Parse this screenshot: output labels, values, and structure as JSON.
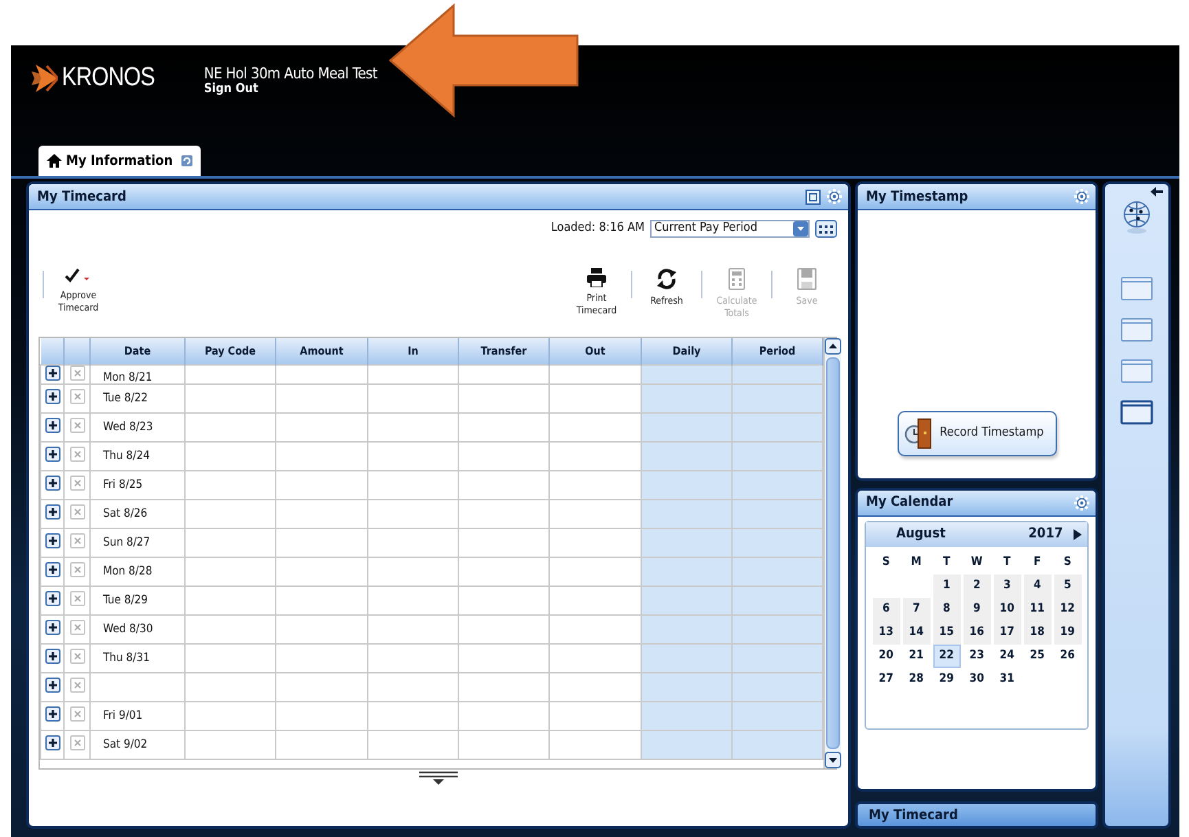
{
  "app": {
    "logo": "KRONOS",
    "user_name": "NE Hol 30m Auto Meal Test",
    "sign_out": "Sign Out"
  },
  "tabs": [
    {
      "label": "My Information",
      "selected": true
    }
  ],
  "timecard": {
    "title": "My Timecard",
    "loaded": "Loaded: 8:16 AM",
    "period": "Current Pay Period",
    "toolbar": [
      {
        "kind": "approve",
        "label": "Approve Timecard",
        "disabled": false
      },
      {
        "kind": "print",
        "label": "Print Timecard",
        "disabled": false
      },
      {
        "kind": "refresh",
        "label": "Refresh",
        "disabled": false
      },
      {
        "kind": "calculate",
        "label": "Calculate Totals",
        "disabled": true
      },
      {
        "kind": "save",
        "label": "Save",
        "disabled": true
      }
    ],
    "columns": [
      "Date",
      "Pay Code",
      "Amount",
      "In",
      "Transfer",
      "Out",
      "Daily",
      "Period"
    ],
    "rows": [
      {
        "date": "Mon 8/21"
      },
      {
        "date": "Tue 8/22"
      },
      {
        "date": "Wed 8/23"
      },
      {
        "date": "Thu 8/24"
      },
      {
        "date": "Fri 8/25"
      },
      {
        "date": "Sat 8/26"
      },
      {
        "date": "Sun 8/27"
      },
      {
        "date": "Mon 8/28"
      },
      {
        "date": "Tue 8/29"
      },
      {
        "date": "Wed 8/30"
      },
      {
        "date": "Thu 8/31"
      },
      {},
      {
        "date": "Fri 9/01"
      },
      {
        "date": "Sat 9/02"
      }
    ]
  },
  "timestamp": {
    "title": "My Timestamp",
    "button": "Record Timestamp"
  },
  "calendar": {
    "title": "My Calendar",
    "month": "August",
    "year": "2017",
    "weekdays": [
      "S",
      "M",
      "T",
      "W",
      "T",
      "F",
      "S"
    ],
    "weeks": [
      {
        "leading_gap": true,
        "days": [
          {
            "label": "1",
            "shaded": true,
            "selected": false
          },
          {
            "label": "2",
            "shaded": true,
            "selected": false
          },
          {
            "label": "3",
            "shaded": true,
            "selected": false
          },
          {
            "label": "4",
            "shaded": true,
            "selected": false
          },
          {
            "label": "5",
            "shaded": true,
            "selected": false
          }
        ]
      },
      {
        "leading_gap": false,
        "days": [
          {
            "label": "6",
            "shaded": true,
            "selected": false
          },
          {
            "label": "7",
            "shaded": true,
            "selected": false
          },
          {
            "label": "8",
            "shaded": true,
            "selected": false
          },
          {
            "label": "9",
            "shaded": true,
            "selected": false
          },
          {
            "label": "10",
            "shaded": true,
            "selected": false
          },
          {
            "label": "11",
            "shaded": true,
            "selected": false
          },
          {
            "label": "12",
            "shaded": true,
            "selected": false
          }
        ]
      },
      {
        "leading_gap": false,
        "days": [
          {
            "label": "13",
            "shaded": true,
            "selected": false
          },
          {
            "label": "14",
            "shaded": true,
            "selected": false
          },
          {
            "label": "15",
            "shaded": true,
            "selected": false
          },
          {
            "label": "16",
            "shaded": true,
            "selected": false
          },
          {
            "label": "17",
            "shaded": true,
            "selected": false
          },
          {
            "label": "18",
            "shaded": true,
            "selected": false
          },
          {
            "label": "19",
            "shaded": true,
            "selected": false
          }
        ]
      },
      {
        "leading_gap": false,
        "days": [
          {
            "label": "20",
            "shaded": false,
            "selected": false
          },
          {
            "label": "21",
            "shaded": false,
            "selected": false
          },
          {
            "label": "22",
            "shaded": false,
            "selected": true
          },
          {
            "label": "23",
            "shaded": false,
            "selected": false
          },
          {
            "label": "24",
            "shaded": false,
            "selected": false
          },
          {
            "label": "25",
            "shaded": false,
            "selected": false
          },
          {
            "label": "26",
            "shaded": false,
            "selected": false
          }
        ]
      },
      {
        "leading_gap": false,
        "days": [
          {
            "label": "27",
            "shaded": false,
            "selected": false
          },
          {
            "label": "28",
            "shaded": false,
            "selected": false
          },
          {
            "label": "29",
            "shaded": false,
            "selected": false
          },
          {
            "label": "30",
            "shaded": false,
            "selected": false
          },
          {
            "label": "31",
            "shaded": false,
            "selected": false
          }
        ]
      }
    ]
  },
  "collapsed_panels": [
    {
      "title": "My Timecard"
    }
  ],
  "rail": {
    "panels": [
      {
        "selected": false
      },
      {
        "selected": false
      },
      {
        "selected": false
      },
      {
        "selected": true
      }
    ]
  }
}
